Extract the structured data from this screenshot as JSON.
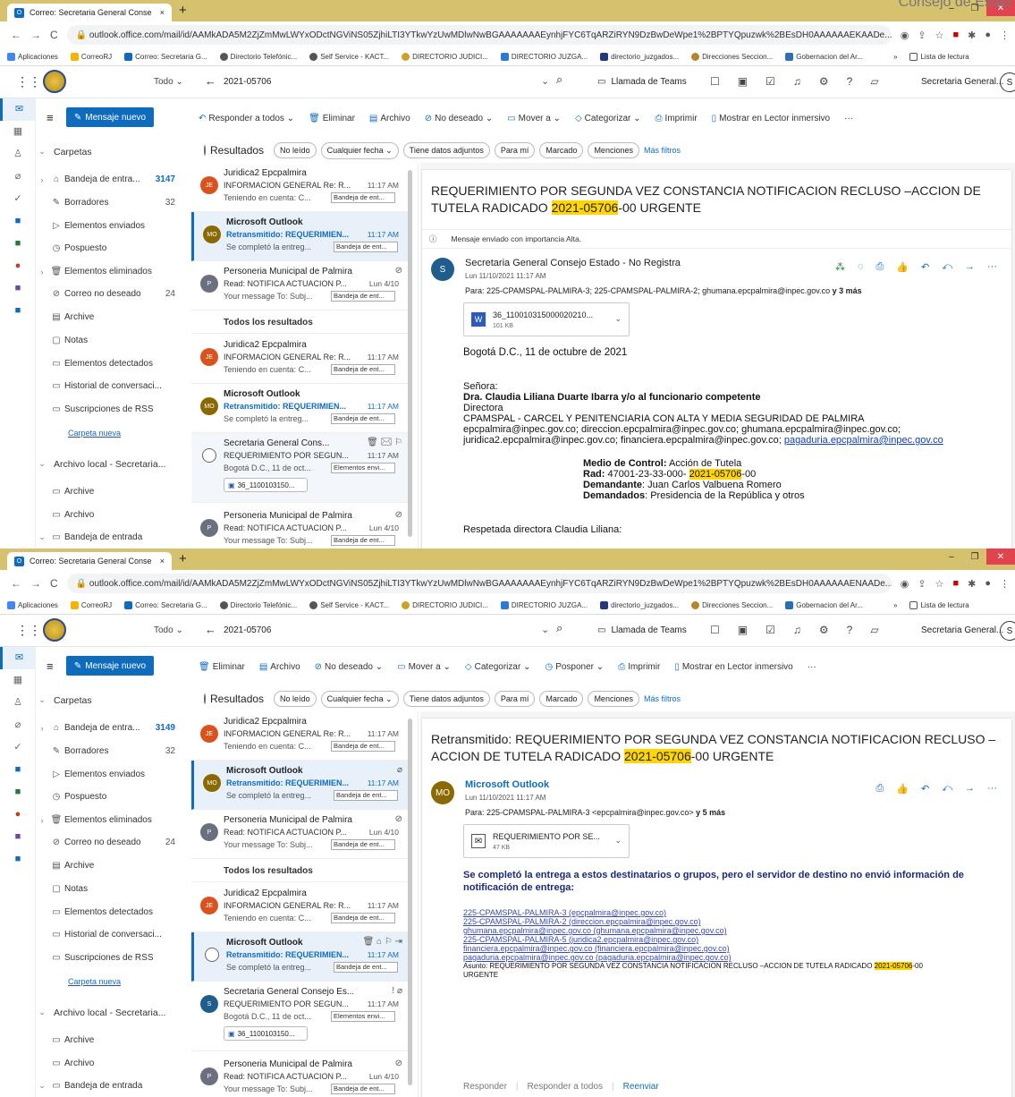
{
  "ghost_text": "Consejo de Estad",
  "browser": {
    "tab_title": "Correo: Secretaria General Conse",
    "tab_close": "×",
    "new_tab": "+",
    "url_1": "outlook.office.com/mail/id/AAMkADA5M2ZjZmMwLWYxODctNGViNS05ZjhiLTI3YTkwYzUwMDlwNwBGAAAAAAAEynhjFYC6TqARZiRYN9DzBwDeWpe1%2BPTYQpuzwk%2BEsDH0AAAAAAEKAADe...",
    "url_2": "outlook.office.com/mail/id/AAMkADA5M2ZjZmMwLWYxODctNGViNS05ZjhiLTI3YTkwYzUwMDlwNwBGAAAAAAAEynhjFYC6TqARZiRYN9DzBwDeWpe1%2BPTYQpuzwk%2BEsDH0AAAAAAENAADe...",
    "bookmarks": [
      "Aplicaciones",
      "CorreoRJ",
      "Correo: Secretaria G...",
      "Directorio Telefónic...",
      "Self Service - KACT...",
      "DIRECTORIO JUDICI...",
      "DIRECTORIO JUZGA...",
      "directorio_juzgados...",
      "Direcciones Seccion...",
      "Gobernacion del Ar..."
    ],
    "bookmarks_more": "»",
    "reading_list": "Lista de lectura"
  },
  "owa": {
    "scope": "Todo",
    "search_text": "2021-05706",
    "teams_call": "Llamada de Teams",
    "account": "Secretaria General...",
    "avatar": "S"
  },
  "nav": {
    "new_mail": "Mensaje nuevo",
    "folders_header": "Carpetas",
    "inbox": "Bandeja de entra...",
    "inbox_count_1": "3147",
    "inbox_count_2": "3149",
    "drafts": "Borradores",
    "drafts_count": "32",
    "sent": "Elementos enviados",
    "postponed": "Pospuesto",
    "deleted": "Elementos eliminados",
    "junk": "Correo no deseado",
    "junk_count": "24",
    "archive": "Archive",
    "notes": "Notas",
    "detected": "Elementos detectados",
    "history": "Historial de conversaci...",
    "rss": "Suscripciones de RSS",
    "new_folder": "Carpeta nueva",
    "local_archive": "Archivo local - Secretaria...",
    "archive2": "Archive",
    "archivo": "Archivo",
    "inbox2": "Bandeja de entrada"
  },
  "cmd1": [
    "Responder a todos",
    "Eliminar",
    "Archivo",
    "No deseado",
    "Mover a",
    "Categorizar",
    "Imprimir",
    "Mostrar en Lector inmersivo",
    "···"
  ],
  "cmd2": [
    "Eliminar",
    "Archivo",
    "No deseado",
    "Mover a",
    "Categorizar",
    "Posponer",
    "Imprimir",
    "Mostrar en Lector inmersivo",
    "···"
  ],
  "filters": {
    "results": "Resultados",
    "pills": [
      "No leído",
      "Cualquier fecha",
      "Tiene datos adjuntos",
      "Para mí",
      "Marcado",
      "Menciones"
    ],
    "more": "Más filtros"
  },
  "list_common": {
    "all_results": "Todos los resultados",
    "juridica_from": "Juridica2 Epcpalmira",
    "juridica_subj": "INFORMACION GENERAL Re: R...",
    "juridica_prev": "Teniendo en cuenta: C...",
    "juridica_init": "JE",
    "outlook_from": "Microsoft Outlook",
    "outlook_subj": "Retransmitido: REQUERIMIEN...",
    "outlook_prev": "Se completó la entreg...",
    "outlook_init": "MO",
    "pers_from": "Personeria Municipal de Palmira",
    "pers_subj": "Read: NOTIFICA ACTUACION P...",
    "pers_prev": "Your message To: Subj...",
    "pers_time": "Lun 4/10",
    "pers_init": "P",
    "time": "11:17 AM",
    "folder_inbox": "Bandeja de ent...",
    "folder_sent": "Elementos envi...",
    "sg_subj": "REQUERIMIENTO POR SEGUN...",
    "sg_prev": "Bogotá D.C., 11 de oct...",
    "sg_att": "36_1100103150...",
    "sg_init": "S"
  },
  "list1": {
    "sg_from": "Secretaria General Cons..."
  },
  "list2": {
    "sg_from": "Secretaria General Consejo Es..."
  },
  "read1": {
    "subject_a": "REQUERIMIENTO POR SEGUNDA VEZ CONSTANCIA NOTIFICACION RECLUSO –ACCION DE TUTELA RADICADO ",
    "subject_hl": "2021-05706",
    "subject_b": "-00 URGENTE",
    "importance": "Mensaje enviado con importancia Alta.",
    "sender": "Secretaria General Consejo Estado - No Registra",
    "sender_init": "S",
    "date": "Lun 11/10/2021 11:17 AM",
    "to": "Para: 225-CPAMSPAL-PALMIRA-3; 225-CPAMSPAL-PALMIRA-2; ghumana.epcpalmira@inpec.gov.co",
    "to_more": " y 3 más",
    "att_name": "36_110010315000020210...",
    "att_size": "101 KB",
    "b_place": "Bogotá D.C., 11 de octubre de 2021",
    "b_sra": "Señora:",
    "b_dra": "Dra. Claudia Liliana Duarte Ibarra y/o al funcionario competente",
    "b_dir": "Directora",
    "b_cpam": "CPAMSPAL - CARCEL Y PENITENCIARIA CON ALTA Y MEDIA SEGURIDAD DE PALMIRA",
    "b_mails1": "epcpalmira@inpec.gov.co; direccion.epcpalmira@inpec.gov.co; ghumana.epcpalmira@inpec.gov.co;",
    "b_mails2": "juridica2.epcpalmira@inpec.gov.co; financiera.epcpalmira@inpec.gov.co; ",
    "b_mails2_link": "pagaduria.epcpalmira@inpec.gov.co",
    "m_label": "Medio de Control:",
    "m_val": " Acción de Tutela",
    "r_label": "Rad:",
    "r_val": " 47001-23-33-000- ",
    "r_hl": "2021-05706",
    "r_tail": "-00",
    "d_label": "Demandante",
    "d_val": ": Juan Carlos Valbuena Romero",
    "dd_label": "Demandados",
    "dd_val": ": Presidencia de la República y otros",
    "greeting": "Respetada directora Claudia Liliana:"
  },
  "read2": {
    "subject_a": "Retransmitido: REQUERIMIENTO POR SEGUNDA VEZ CONSTANCIA NOTIFICACION RECLUSO – ACCION DE TUTELA RADICADO ",
    "subject_hl": "2021-05706",
    "subject_b": "-00 URGENTE",
    "sender": "Microsoft Outlook",
    "sender_init": "MO",
    "date": "Lun 11/10/2021 11:17 AM",
    "to": "Para: 225-CPAMSPAL-PALMIRA-3 <epcpalmira@inpec.gov.co>",
    "to_more": " y 5 más",
    "att_name": "REQUERIMIENTO POR SE...",
    "att_size": "47 KB",
    "notice": "Se completó la entrega a estos destinatarios o grupos, pero el servidor de destino no envió información de notificación de entrega:",
    "recipients": [
      "225-CPAMSPAL-PALMIRA-3 (epcpalmira@inpec.gov.co)",
      "225-CPAMSPAL-PALMIRA-2 (direccion.epcpalmira@inpec.gov.co)",
      "ghumana.epcpalmira@inpec.gov.co (ghumana.epcpalmira@inpec.gov.co)",
      "225-CPAMSPAL-PALMIRA-5 (juridica2.epcpalmira@inpec.gov.co)",
      "financiera.epcpalmira@inpec.gov.co (financiera.epcpalmira@inpec.gov.co)",
      "pagaduria.epcpalmira@inpec.gov.co (pagaduria.epcpalmira@inpec.gov.co)"
    ],
    "asunto_a": "Asunto: REQUERIMIENTO POR SEGUNDA VEZ CONSTANCIA NOTIFICACION RECLUSO –ACCION DE TUTELA RADICADO ",
    "asunto_hl": "2021-05706",
    "asunto_b": "-00",
    "asunto_c": "URGENTE",
    "reply": "Responder",
    "reply_all": "Responder a todos",
    "forward": "Reenviar"
  },
  "colors": {
    "accent": "#0f6cbd",
    "tabbar": "#d6c16e",
    "highlight": "#ffd600"
  }
}
